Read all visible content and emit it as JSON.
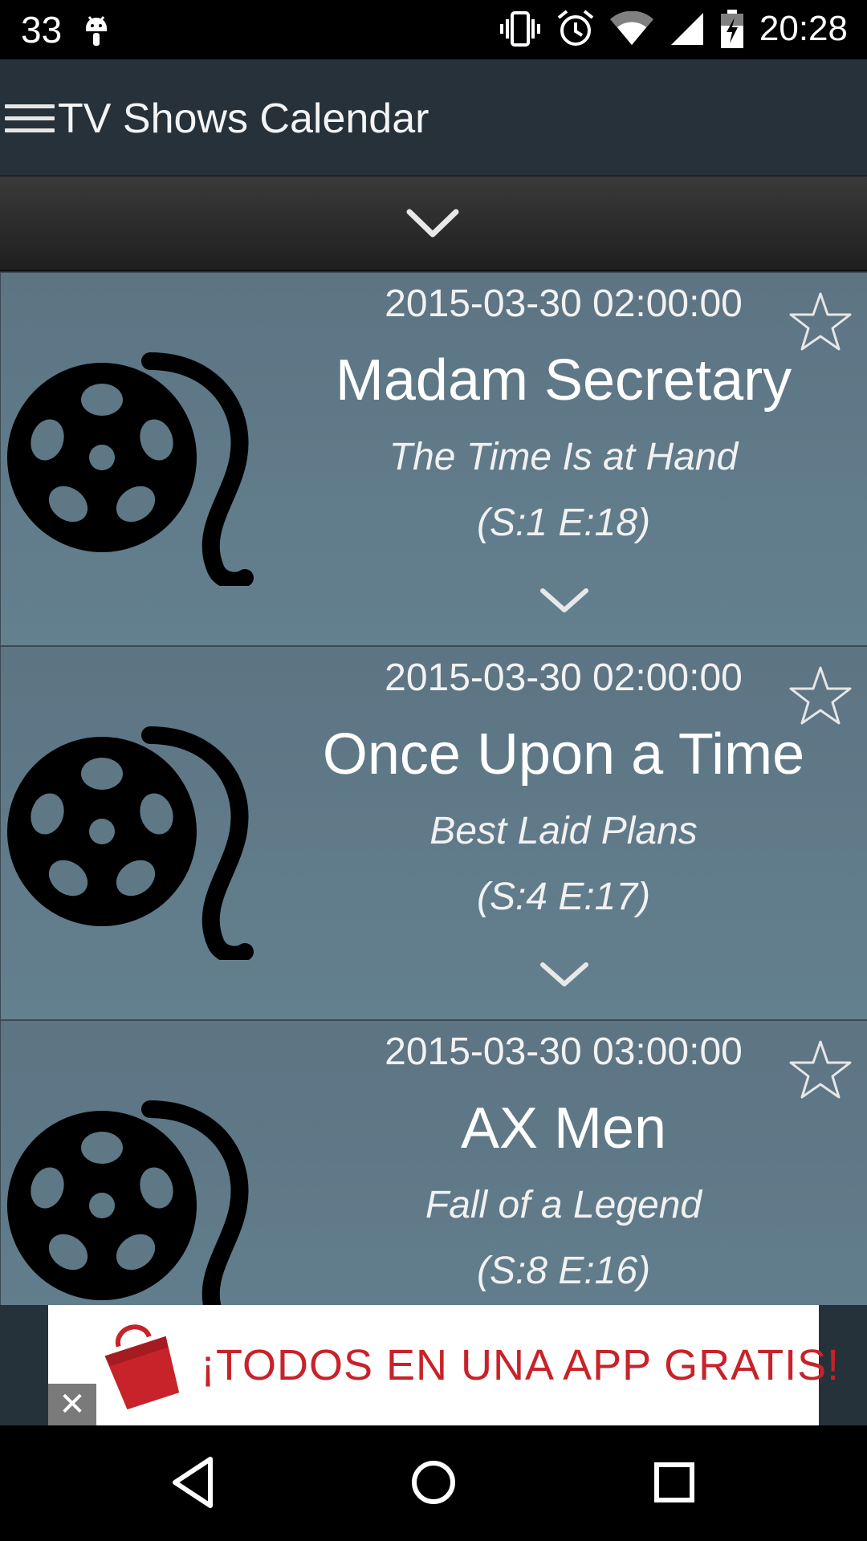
{
  "status_bar": {
    "notification_count": "33",
    "time": "20:28",
    "icons": [
      "android-icon",
      "vibrate-icon",
      "alarm-icon",
      "wifi-icon",
      "signal-icon",
      "battery-charging-icon"
    ]
  },
  "app_bar": {
    "menu_icon": "hamburger-menu-icon",
    "title": "TV Shows Calendar"
  },
  "collapse_bar": {
    "icon": "chevron-down-icon"
  },
  "shows": [
    {
      "air_date": "2015-03-30 02:00:00",
      "title": "Madam Secretary",
      "episode_title": "The Time Is at Hand",
      "episode_number": "(S:1 E:18)",
      "favorite_icon": "star-outline-icon",
      "image_icon": "film-reel-icon",
      "expand_icon": "chevron-down-icon"
    },
    {
      "air_date": "2015-03-30 02:00:00",
      "title": "Once Upon a Time",
      "episode_title": "Best Laid Plans",
      "episode_number": "(S:4 E:17)",
      "favorite_icon": "star-outline-icon",
      "image_icon": "film-reel-icon",
      "expand_icon": "chevron-down-icon"
    },
    {
      "air_date": "2015-03-30 03:00:00",
      "title": "AX Men",
      "episode_title": "Fall of a Legend",
      "episode_number": "(S:8 E:16)",
      "favorite_icon": "star-outline-icon",
      "image_icon": "film-reel-icon",
      "expand_icon": "chevron-down-icon"
    }
  ],
  "ad_banner": {
    "text": "¡TODOS EN UNA APP GRATIS!",
    "close_label": "✕",
    "accent_color": "#c8222a"
  },
  "nav_bar": {
    "icons": [
      "back-icon",
      "home-icon",
      "recents-icon"
    ]
  },
  "colors": {
    "item_background": "#5f7886",
    "app_bar": "#27313a",
    "status_bar": "#000000"
  }
}
